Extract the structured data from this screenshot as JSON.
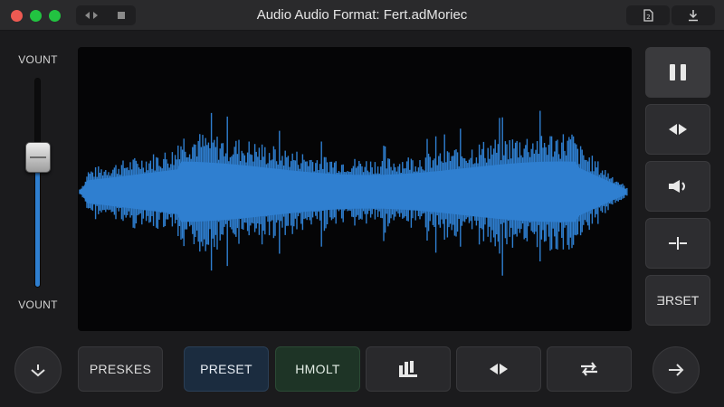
{
  "window": {
    "title": "Audio Audio Format: Fert.adMoriec"
  },
  "titlebar": {
    "left_icons": [
      "arrows-horizontal-icon",
      "square-icon"
    ],
    "right_icons": [
      "document-badge-icon",
      "download-icon"
    ]
  },
  "volume": {
    "top_label": "VOUNT",
    "bottom_label": "VOUNT",
    "level": 0.62
  },
  "side_buttons": [
    {
      "name": "pause-button",
      "icon": "pause-icon",
      "label": ""
    },
    {
      "name": "rewind-button",
      "icon": "diamond-arrows-icon",
      "label": ""
    },
    {
      "name": "speaker-button",
      "icon": "speaker-icon",
      "label": ""
    },
    {
      "name": "split-button",
      "icon": "split-cursor-icon",
      "label": ""
    },
    {
      "name": "reset-button",
      "icon": "",
      "label": "ƎRSET"
    }
  ],
  "bottom_buttons": [
    {
      "name": "preskes-button",
      "label": "PRESKES"
    },
    {
      "name": "preset-button",
      "label": "PRESET"
    },
    {
      "name": "hmolt-button",
      "label": "HMOLT"
    },
    {
      "name": "bars-button",
      "icon": "bars-icon",
      "label": ""
    },
    {
      "name": "diamond-button",
      "icon": "diamond-arrows-icon",
      "label": ""
    },
    {
      "name": "loop-button",
      "icon": "loop-icon",
      "label": ""
    }
  ],
  "bottom_round": {
    "left_icon": "chevron-down-icon",
    "right_icon": "arrow-right-icon"
  },
  "colors": {
    "waveform": "#2f7fd0",
    "background": "#1b1b1d",
    "panel": "#050506",
    "preset_active": "#1b2c3f",
    "hmolt_active": "#1e3426"
  }
}
